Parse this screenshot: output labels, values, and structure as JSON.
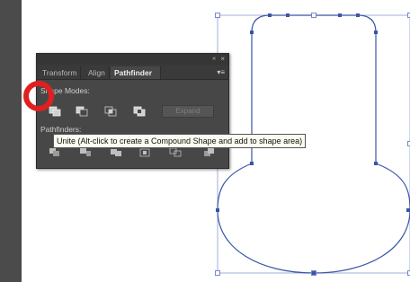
{
  "panel": {
    "collapse_glyph": "«",
    "close_glyph": "×",
    "tabs": [
      {
        "label": "Transform"
      },
      {
        "label": "Align"
      },
      {
        "label": "Pathfinder"
      }
    ],
    "menu_glyph": "▾≡",
    "shape_modes_label": "Shape Modes:",
    "pathfinders_label": "Pathfinders:",
    "expand_label": "Expand",
    "shape_mode_icons": [
      "unite-icon",
      "minus-front-icon",
      "intersect-icon",
      "exclude-icon"
    ],
    "pathfinder_icons": [
      "divide-icon",
      "trim-icon",
      "merge-icon",
      "crop-icon",
      "outline-icon",
      "minus-back-icon"
    ]
  },
  "tooltip": {
    "text": "Unite (Alt-click to create a Compound Shape and add to shape area)"
  },
  "colors": {
    "highlight": "#e02020",
    "path_stroke": "#3a55a8",
    "panel_bg": "#474747"
  }
}
